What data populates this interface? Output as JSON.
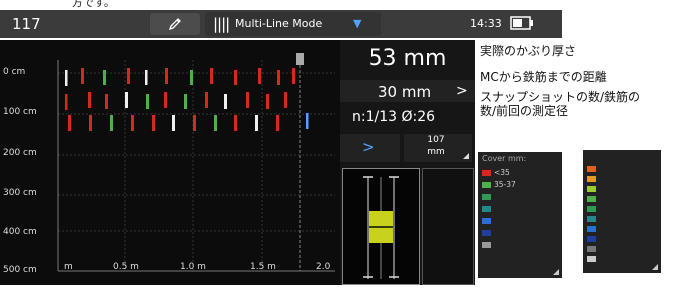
{
  "header": {
    "top_snippet": "方です。",
    "id": "117",
    "mode_label": "Multi-Line Mode",
    "time": "14:33"
  },
  "plot": {
    "y_labels": [
      "0 cm",
      "100 cm",
      "200 cm",
      "300 cm",
      "400 cm",
      "500 cm"
    ],
    "x_labels": [
      "m",
      "0.5 m",
      "1.0 m",
      "1.5 m",
      "2.0"
    ]
  },
  "panel": {
    "cover_value": "53 mm",
    "distance_value": "30 mm",
    "snapshot_text": "n:1/13  Ø:26",
    "diameter_value": "107",
    "diameter_unit": "mm"
  },
  "annotations": {
    "cover": "実際のかぶり厚さ",
    "distance": "MCから鉄筋までの距離",
    "snapshot_line1": "スナップショットの数/鉄筋の",
    "snapshot_line2": "数/前回の測定径"
  },
  "cover_legend": {
    "title": "Cover mm:",
    "items": [
      {
        "label": "<35",
        "color": "#d42a1e"
      },
      {
        "label": "35-37",
        "color": "#4db04a"
      },
      {
        "label": "",
        "color": "#2f9a55"
      },
      {
        "label": "",
        "color": "#1e8a8a"
      },
      {
        "label": "",
        "color": "#2a6fd6"
      },
      {
        "label": "",
        "color": "#1f3ea0"
      },
      {
        "label": "",
        "color": "#9a9a9a"
      }
    ]
  },
  "diameter_legend": {
    "title": "",
    "items": [
      {
        "label": "",
        "color": "#e0621e"
      },
      {
        "label": "",
        "color": "#e89a1e"
      },
      {
        "label": "",
        "color": "#9ccc2a"
      },
      {
        "label": "",
        "color": "#4db04a"
      },
      {
        "label": "",
        "color": "#2f9a55"
      },
      {
        "label": "",
        "color": "#1e8a8a"
      },
      {
        "label": "",
        "color": "#2a6fd6"
      },
      {
        "label": "",
        "color": "#1f3ea0"
      },
      {
        "label": "",
        "color": "#777777"
      },
      {
        "label": "",
        "color": "#cccccc"
      }
    ]
  },
  "colors": {
    "accent_blue": "#4fa3ff",
    "rebar_red": "#d42a1e",
    "rebar_green": "#4db04a",
    "marker_yellow": "#c8d21e"
  }
}
